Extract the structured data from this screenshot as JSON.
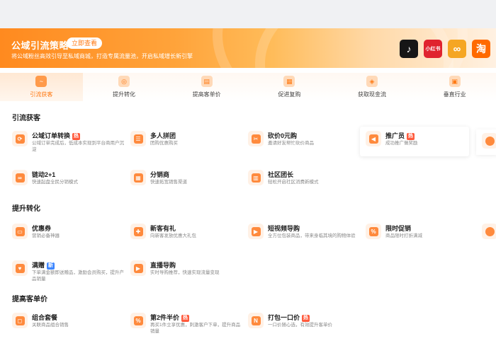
{
  "banner": {
    "title": "公域引流策略",
    "cta": "立即查看",
    "subtitle": "将公域粉丝高效引导至私域商城，打造专属流量池，开启私域增长新引擎",
    "platforms": [
      {
        "name": "tiktok-icon",
        "label": "♪",
        "color": "#161616"
      },
      {
        "name": "xiaohongshu-icon",
        "label": "小红书",
        "color": "#e0232e"
      },
      {
        "name": "wechat-channels-icon",
        "label": "∞",
        "color": "#f5a623"
      },
      {
        "name": "taobao-icon",
        "label": "淘",
        "color": "#ff6a00"
      }
    ]
  },
  "tabs": [
    {
      "label": "引流获客",
      "icon": "~",
      "active": true
    },
    {
      "label": "提升转化",
      "icon": "◎",
      "active": false
    },
    {
      "label": "提高客单价",
      "icon": "▤",
      "active": false
    },
    {
      "label": "促进复购",
      "icon": "▦",
      "active": false
    },
    {
      "label": "获取现金流",
      "icon": "◈",
      "active": false
    },
    {
      "label": "垂直行业",
      "icon": "▣",
      "active": false
    }
  ],
  "sections": [
    {
      "title": "引流获客"
    },
    {
      "title": "提升转化"
    },
    {
      "title": "提高客单价"
    }
  ],
  "items": {
    "s1": [
      {
        "name": "公域订单转换",
        "badge": "热",
        "desc": "公域订单完成后，低成本实现到平台商用户沉淀",
        "glyph": "⟳"
      },
      {
        "name": "多人拼团",
        "badge": "",
        "desc": "团购优惠购买",
        "glyph": "☰"
      },
      {
        "name": "砍价0元购",
        "badge": "",
        "desc": "邀请好友帮忙砍价商品",
        "glyph": "✂"
      },
      {
        "name": "推广员",
        "badge": "热",
        "desc": "成功推广做奖励",
        "glyph": "◀"
      },
      {
        "name": "链动2+1",
        "badge": "",
        "desc": "快速起盘全民分销模式",
        "glyph": "∞"
      },
      {
        "name": "分销商",
        "badge": "",
        "desc": "快速拓宽销售渠道",
        "glyph": "▦"
      },
      {
        "name": "社区团长",
        "badge": "",
        "desc": "轻松开启社区消费新模式",
        "glyph": "▥"
      }
    ],
    "s2": [
      {
        "name": "优惠券",
        "badge": "",
        "desc": "营销必备神器",
        "glyph": "▭"
      },
      {
        "name": "新客有礼",
        "badge": "",
        "desc": "向新客发放优惠大礼包",
        "glyph": "✚"
      },
      {
        "name": "短视频导购",
        "badge": "",
        "desc": "全方位包装商品，带来身临其境的购物体验",
        "glyph": "▶"
      },
      {
        "name": "限时促销",
        "badge": "",
        "desc": "商品限时打折满减",
        "glyph": "%"
      },
      {
        "name": "满赠",
        "badge": "新",
        "desc": "下单满金额即送赠品，激励会员购买，提升产品销量",
        "glyph": "♥"
      },
      {
        "name": "直播导购",
        "badge": "",
        "desc": "实时导购推荐，快速实现流量变现",
        "glyph": "▶"
      }
    ],
    "s3": [
      {
        "name": "组合套餐",
        "badge": "",
        "desc": "关联商品组合销售",
        "glyph": "◻"
      },
      {
        "name": "第2件半价",
        "badge": "热",
        "desc": "再买1件立享优惠，刺激客户下单，提升商品销量",
        "glyph": "%"
      },
      {
        "name": "打包一口价",
        "badge": "热",
        "desc": "一口价随心选，有效提升客单价",
        "glyph": "N"
      }
    ]
  }
}
